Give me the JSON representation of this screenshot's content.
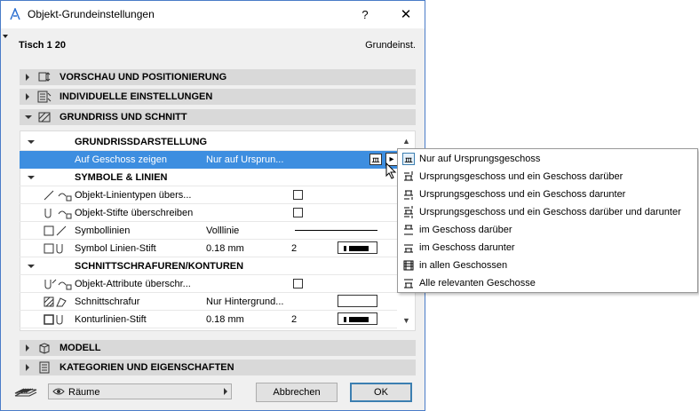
{
  "window": {
    "title": "Objekt-Grundeinstellungen",
    "help_label": "?",
    "close_label": "✕"
  },
  "object": {
    "name": "Tisch 1 20",
    "tag": "Grundeinst."
  },
  "sections": {
    "preview": "VORSCHAU UND POSITIONIERUNG",
    "custom": "INDIVIDUELLE EINSTELLUNGEN",
    "plan": "GRUNDRISS UND SCHNITT",
    "model": "MODELL",
    "categories": "KATEGORIEN UND EIGENSCHAFTEN"
  },
  "plan_panel": {
    "grp_display": "GRUNDRISSDARSTELLUNG",
    "show_on_story_label": "Auf Geschoss zeigen",
    "show_on_story_value": "Nur auf Ursprun...",
    "grp_symbol": "SYMBOLE & LINIEN",
    "obj_linetypes_label": "Objekt-Linientypen übers...",
    "obj_pens_label": "Objekt-Stifte überschreiben",
    "symbol_lines_label": "Symbollinien",
    "symbol_lines_value": "Volllinie",
    "symbol_pen_label": "Symbol Linien-Stift",
    "symbol_pen_value": "0.18 mm",
    "symbol_pen_num": "2",
    "grp_cut": "SCHNITTSCHRAFUREN/KONTUREN",
    "obj_attr_label": "Objekt-Attribute überschr...",
    "cut_fill_label": "Schnittschrafur",
    "cut_fill_value": "Nur Hintergrund...",
    "contour_pen_label": "Konturlinien-Stift",
    "contour_pen_value": "0.18 mm",
    "contour_pen_num": "2"
  },
  "footer": {
    "combo_value": "Räume",
    "cancel_label": "Abbrechen",
    "ok_label": "OK"
  },
  "popup": {
    "items": [
      "Nur auf Ursprungsgeschoss",
      "Ursprungsgeschoss und ein Geschoss darüber",
      "Ursprungsgeschoss und ein Geschoss darunter",
      "Ursprungsgeschoss und ein Geschoss darüber und darunter",
      "im Geschoss darüber",
      "im Geschoss darunter",
      "in allen Geschossen",
      "Alle relevanten Geschosse"
    ]
  },
  "colors": {
    "selection": "#3d8ee0",
    "section_bar": "#d9d9d9",
    "window_border": "#4a7cc8"
  }
}
